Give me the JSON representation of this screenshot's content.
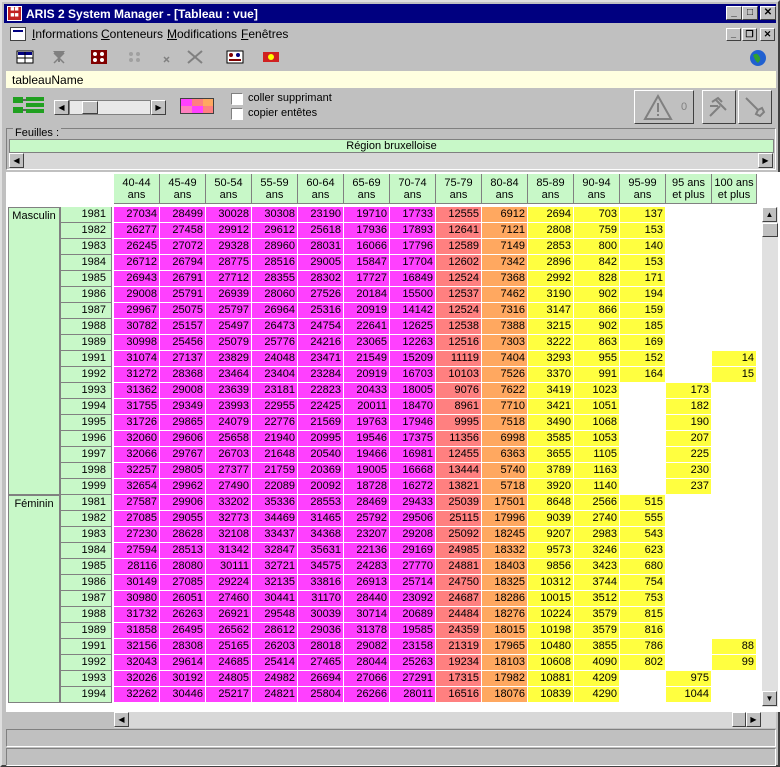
{
  "window": {
    "title": "ARIS 2 System Manager - [Tableau : vue]"
  },
  "menu": [
    {
      "label": "Informations",
      "u": "I",
      "rest": "nformations"
    },
    {
      "label": "Conteneurs",
      "u": "C",
      "rest": "onteneurs"
    },
    {
      "label": "Modifications",
      "u": "M",
      "rest": "odifications"
    },
    {
      "label": "Fenêtres",
      "u": "F",
      "rest": "enêtres"
    }
  ],
  "table_name": "tableauName",
  "options": {
    "paste_delete": "coller supprimant",
    "copy_headers": "copier entêtes"
  },
  "warning_count": "0",
  "sheets_label": "Feuilles :",
  "region": "Région bruxelloise",
  "colors": {
    "magenta": "#ff40ff",
    "salmon": "#ff8080",
    "orange": "#ffa860",
    "yellow": "#ffff40",
    "header_green": "#c8f8c8",
    "title_blue": "#000080"
  },
  "columns": [
    "40-44 ans",
    "45-49 ans",
    "50-54 ans",
    "55-59 ans",
    "60-64 ans",
    "65-69 ans",
    "70-74 ans",
    "75-79 ans",
    "80-84 ans",
    "85-89 ans",
    "90-94 ans",
    "95-99 ans",
    "95 ans et plus",
    "100 ans et plus"
  ],
  "sexes": [
    "Masculin",
    "Féminin"
  ],
  "rows": [
    {
      "sex": "Masculin",
      "year": "1981",
      "v": [
        "27034",
        "28499",
        "30028",
        "30308",
        "23190",
        "19710",
        "17733",
        "12555",
        "6912",
        "2694",
        "703",
        "137",
        "",
        ""
      ]
    },
    {
      "sex": "Masculin",
      "year": "1982",
      "v": [
        "26277",
        "27458",
        "29912",
        "29612",
        "25618",
        "17936",
        "17893",
        "12641",
        "7121",
        "2808",
        "759",
        "153",
        "",
        ""
      ]
    },
    {
      "sex": "Masculin",
      "year": "1983",
      "v": [
        "26245",
        "27072",
        "29328",
        "28960",
        "28031",
        "16066",
        "17796",
        "12589",
        "7149",
        "2853",
        "800",
        "140",
        "",
        ""
      ]
    },
    {
      "sex": "Masculin",
      "year": "1984",
      "v": [
        "26712",
        "26794",
        "28775",
        "28516",
        "29005",
        "15847",
        "17704",
        "12602",
        "7342",
        "2896",
        "842",
        "153",
        "",
        ""
      ]
    },
    {
      "sex": "Masculin",
      "year": "1985",
      "v": [
        "26943",
        "26791",
        "27712",
        "28355",
        "28302",
        "17727",
        "16849",
        "12524",
        "7368",
        "2992",
        "828",
        "171",
        "",
        ""
      ]
    },
    {
      "sex": "Masculin",
      "year": "1986",
      "v": [
        "29008",
        "25791",
        "26939",
        "28060",
        "27526",
        "20184",
        "15500",
        "12537",
        "7462",
        "3190",
        "902",
        "194",
        "",
        ""
      ]
    },
    {
      "sex": "Masculin",
      "year": "1987",
      "v": [
        "29967",
        "25075",
        "25797",
        "26964",
        "25316",
        "20919",
        "14142",
        "12524",
        "7316",
        "3147",
        "866",
        "159",
        "",
        ""
      ]
    },
    {
      "sex": "Masculin",
      "year": "1988",
      "v": [
        "30782",
        "25157",
        "25497",
        "26473",
        "24754",
        "22641",
        "12625",
        "12538",
        "7388",
        "3215",
        "902",
        "185",
        "",
        ""
      ]
    },
    {
      "sex": "Masculin",
      "year": "1989",
      "v": [
        "30998",
        "25456",
        "25079",
        "25776",
        "24216",
        "23065",
        "12263",
        "12516",
        "7303",
        "3222",
        "863",
        "169",
        "",
        ""
      ]
    },
    {
      "sex": "Masculin",
      "year": "1991",
      "v": [
        "31074",
        "27137",
        "23829",
        "24048",
        "23471",
        "21549",
        "15209",
        "11119",
        "7404",
        "3293",
        "955",
        "152",
        "",
        "14"
      ]
    },
    {
      "sex": "Masculin",
      "year": "1992",
      "v": [
        "31272",
        "28368",
        "23464",
        "23404",
        "23284",
        "20919",
        "16703",
        "10103",
        "7526",
        "3370",
        "991",
        "164",
        "",
        "15"
      ]
    },
    {
      "sex": "Masculin",
      "year": "1993",
      "v": [
        "31362",
        "29008",
        "23639",
        "23181",
        "22823",
        "20433",
        "18005",
        "9076",
        "7622",
        "3419",
        "1023",
        "",
        "173",
        ""
      ]
    },
    {
      "sex": "Masculin",
      "year": "1994",
      "v": [
        "31755",
        "29349",
        "23993",
        "22955",
        "22425",
        "20011",
        "18470",
        "8961",
        "7710",
        "3421",
        "1051",
        "",
        "182",
        ""
      ]
    },
    {
      "sex": "Masculin",
      "year": "1995",
      "v": [
        "31726",
        "29865",
        "24079",
        "22776",
        "21569",
        "19763",
        "17946",
        "9995",
        "7518",
        "3490",
        "1068",
        "",
        "190",
        ""
      ]
    },
    {
      "sex": "Masculin",
      "year": "1996",
      "v": [
        "32060",
        "29606",
        "25658",
        "21940",
        "20995",
        "19546",
        "17375",
        "11356",
        "6998",
        "3585",
        "1053",
        "",
        "207",
        ""
      ]
    },
    {
      "sex": "Masculin",
      "year": "1997",
      "v": [
        "32066",
        "29767",
        "26703",
        "21648",
        "20540",
        "19466",
        "16981",
        "12455",
        "6363",
        "3655",
        "1105",
        "",
        "225",
        ""
      ]
    },
    {
      "sex": "Masculin",
      "year": "1998",
      "v": [
        "32257",
        "29805",
        "27377",
        "21759",
        "20369",
        "19005",
        "16668",
        "13444",
        "5740",
        "3789",
        "1163",
        "",
        "230",
        ""
      ]
    },
    {
      "sex": "Masculin",
      "year": "1999",
      "v": [
        "32654",
        "29962",
        "27490",
        "22089",
        "20092",
        "18728",
        "16272",
        "13821",
        "5718",
        "3920",
        "1140",
        "",
        "237",
        ""
      ]
    },
    {
      "sex": "Féminin",
      "year": "1981",
      "v": [
        "27587",
        "29906",
        "33202",
        "35336",
        "28553",
        "28469",
        "29433",
        "25039",
        "17501",
        "8648",
        "2566",
        "515",
        "",
        ""
      ]
    },
    {
      "sex": "Féminin",
      "year": "1982",
      "v": [
        "27085",
        "29055",
        "32773",
        "34469",
        "31465",
        "25792",
        "29506",
        "25115",
        "17996",
        "9039",
        "2740",
        "555",
        "",
        ""
      ]
    },
    {
      "sex": "Féminin",
      "year": "1983",
      "v": [
        "27230",
        "28628",
        "32108",
        "33437",
        "34368",
        "23207",
        "29208",
        "25092",
        "18245",
        "9207",
        "2983",
        "543",
        "",
        ""
      ]
    },
    {
      "sex": "Féminin",
      "year": "1984",
      "v": [
        "27594",
        "28513",
        "31342",
        "32847",
        "35631",
        "22136",
        "29169",
        "24985",
        "18332",
        "9573",
        "3246",
        "623",
        "",
        ""
      ]
    },
    {
      "sex": "Féminin",
      "year": "1985",
      "v": [
        "28116",
        "28080",
        "30111",
        "32721",
        "34575",
        "24283",
        "27770",
        "24881",
        "18403",
        "9856",
        "3423",
        "680",
        "",
        ""
      ]
    },
    {
      "sex": "Féminin",
      "year": "1986",
      "v": [
        "30149",
        "27085",
        "29224",
        "32135",
        "33816",
        "26913",
        "25714",
        "24750",
        "18325",
        "10312",
        "3744",
        "754",
        "",
        ""
      ]
    },
    {
      "sex": "Féminin",
      "year": "1987",
      "v": [
        "30980",
        "26051",
        "27460",
        "30441",
        "31170",
        "28440",
        "23092",
        "24687",
        "18286",
        "10015",
        "3512",
        "753",
        "",
        ""
      ]
    },
    {
      "sex": "Féminin",
      "year": "1988",
      "v": [
        "31732",
        "26263",
        "26921",
        "29548",
        "30039",
        "30714",
        "20689",
        "24484",
        "18276",
        "10224",
        "3579",
        "815",
        "",
        ""
      ]
    },
    {
      "sex": "Féminin",
      "year": "1989",
      "v": [
        "31858",
        "26495",
        "26562",
        "28612",
        "29036",
        "31378",
        "19585",
        "24359",
        "18015",
        "10198",
        "3579",
        "816",
        "",
        ""
      ]
    },
    {
      "sex": "Féminin",
      "year": "1991",
      "v": [
        "32156",
        "28308",
        "25165",
        "26203",
        "28018",
        "29082",
        "23158",
        "21319",
        "17965",
        "10480",
        "3855",
        "786",
        "",
        "88"
      ]
    },
    {
      "sex": "Féminin",
      "year": "1992",
      "v": [
        "32043",
        "29614",
        "24685",
        "25414",
        "27465",
        "28044",
        "25263",
        "19234",
        "18103",
        "10608",
        "4090",
        "802",
        "",
        "99"
      ]
    },
    {
      "sex": "Féminin",
      "year": "1993",
      "v": [
        "32026",
        "30192",
        "24805",
        "24982",
        "26694",
        "27066",
        "27291",
        "17315",
        "17982",
        "10881",
        "4209",
        "",
        "975",
        ""
      ]
    },
    {
      "sex": "Féminin",
      "year": "1994",
      "v": [
        "32262",
        "30446",
        "25217",
        "24821",
        "25804",
        "26266",
        "28011",
        "16516",
        "18076",
        "10839",
        "4290",
        "",
        "1044",
        ""
      ]
    }
  ]
}
